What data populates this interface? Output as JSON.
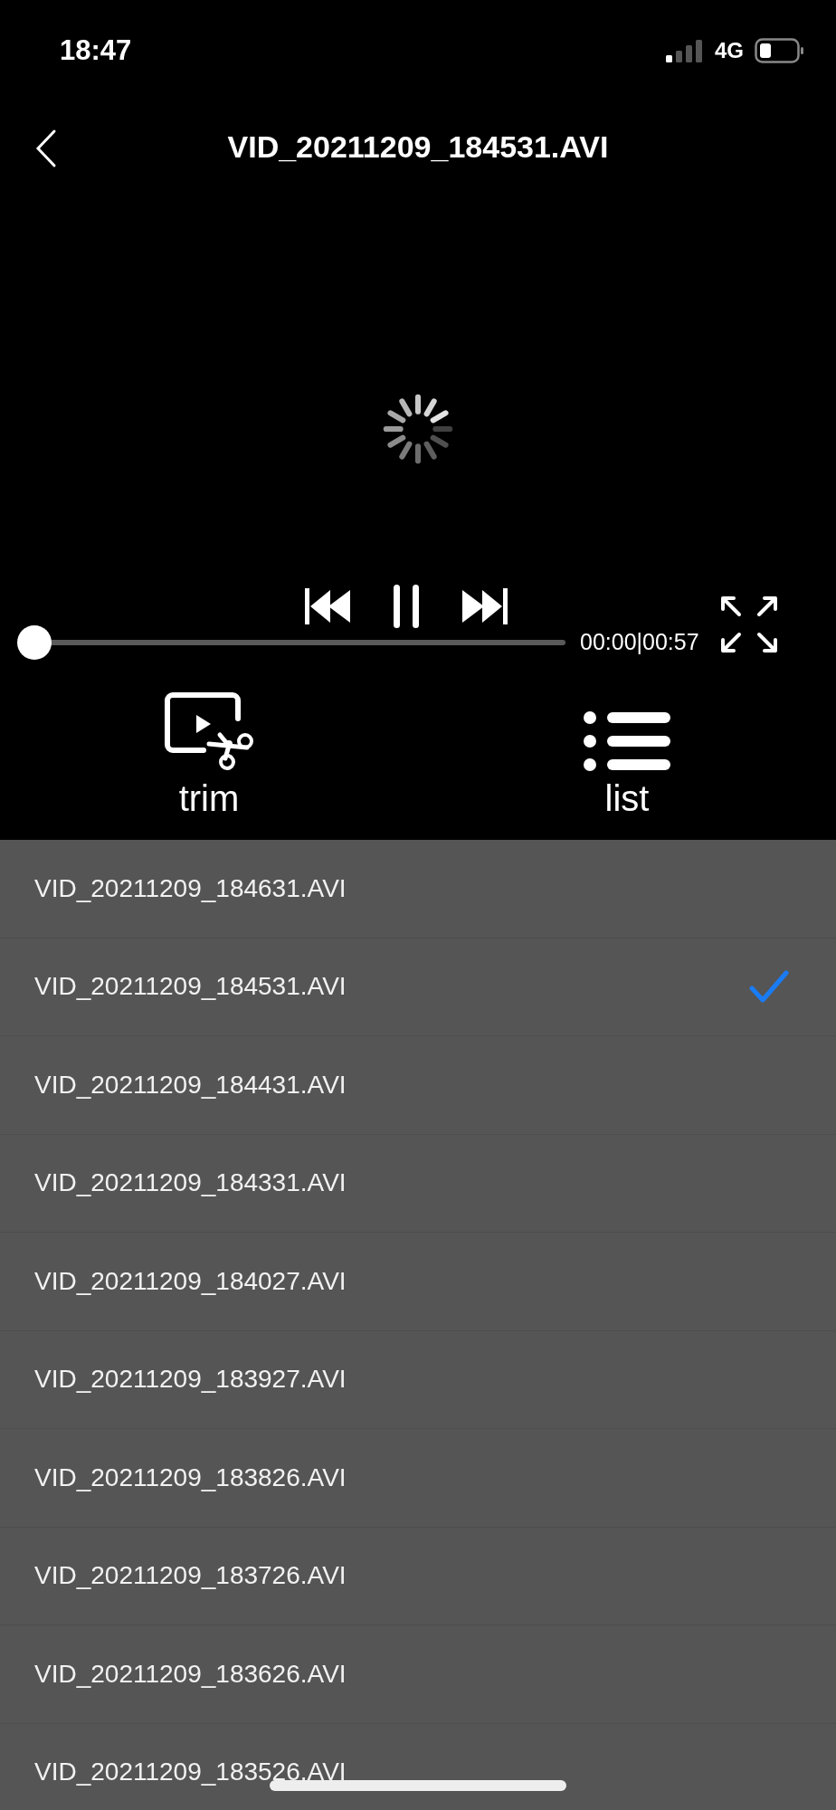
{
  "status_bar": {
    "time": "18:47",
    "network": "4G"
  },
  "header": {
    "title": "VID_20211209_184531.AVI"
  },
  "player": {
    "loading": true,
    "playing": true,
    "progress": {
      "level": 0
    },
    "time": "00:00|00:57"
  },
  "actions": [
    {
      "kind": "trim",
      "label": "trim"
    },
    {
      "kind": "list",
      "label": "list"
    }
  ],
  "files": [
    {
      "name": "VID_20211209_184631.AVI",
      "selected": false
    },
    {
      "name": "VID_20211209_184531.AVI",
      "selected": true
    },
    {
      "name": "VID_20211209_184431.AVI",
      "selected": false
    },
    {
      "name": "VID_20211209_184331.AVI",
      "selected": false
    },
    {
      "name": "VID_20211209_184027.AVI",
      "selected": false
    },
    {
      "name": "VID_20211209_183927.AVI",
      "selected": false
    },
    {
      "name": "VID_20211209_183826.AVI",
      "selected": false
    },
    {
      "name": "VID_20211209_183726.AVI",
      "selected": false
    },
    {
      "name": "VID_20211209_183626.AVI",
      "selected": false
    },
    {
      "name": "VID_20211209_183526.AVI",
      "selected": false
    }
  ]
}
